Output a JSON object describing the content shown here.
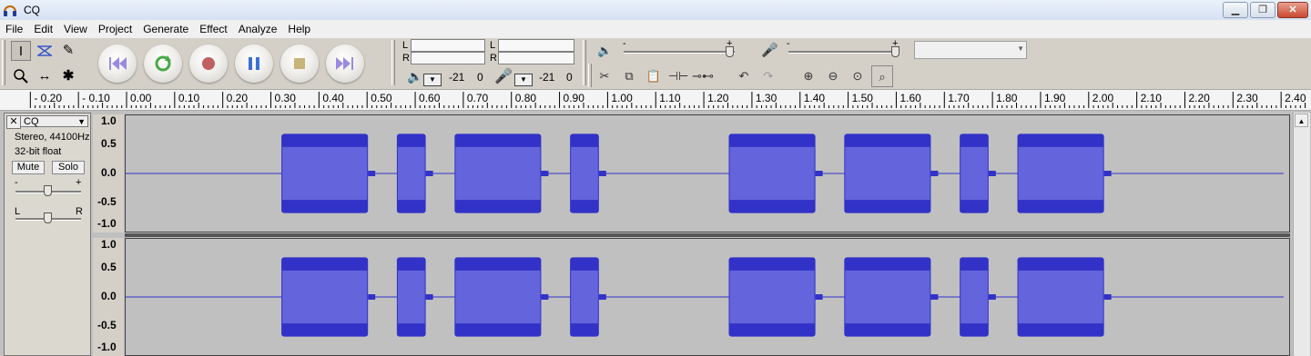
{
  "window": {
    "title": "CQ"
  },
  "menu": [
    "File",
    "Edit",
    "View",
    "Project",
    "Generate",
    "Effect",
    "Analyze",
    "Help"
  ],
  "meters": {
    "play": {
      "left_label": "L",
      "right_label": "R",
      "db_label": "-21",
      "zero_label": "0"
    },
    "record": {
      "left_label": "L",
      "right_label": "R",
      "db_label": "-21",
      "zero_label": "0"
    }
  },
  "mixer": {
    "output_min": "-",
    "output_max": "+",
    "input_min": "-",
    "input_max": "+"
  },
  "ruler": {
    "ticks": [
      "- 0.20",
      "- 0.10",
      "0.00",
      "0.10",
      "0.20",
      "0.30",
      "0.40",
      "0.50",
      "0.60",
      "0.70",
      "0.80",
      "0.90",
      "1.00",
      "1.10",
      "1.20",
      "1.30",
      "1.40",
      "1.50",
      "1.60",
      "1.70",
      "1.80",
      "1.90",
      "2.00",
      "2.10",
      "2.20",
      "2.30",
      "2.40"
    ]
  },
  "track": {
    "name": "CQ",
    "format": "Stereo, 44100Hz",
    "bitdepth": "32-bit float",
    "mute_label": "Mute",
    "solo_label": "Solo",
    "gain_min": "-",
    "gain_max": "+",
    "pan_left": "L",
    "pan_right": "R",
    "scale": [
      "1.0",
      "0.5",
      "0.0",
      "-0.5",
      "-1.0"
    ],
    "bursts": [
      [
        0.32,
        0.5
      ],
      [
        0.56,
        0.62
      ],
      [
        0.68,
        0.86
      ],
      [
        0.92,
        0.98
      ],
      [
        1.25,
        1.43
      ],
      [
        1.49,
        1.67
      ],
      [
        1.73,
        1.79
      ],
      [
        1.85,
        2.03
      ]
    ]
  },
  "colors": {
    "waveform": "#3232c8",
    "waveform_rms": "#6464dc",
    "background": "#d4d0c8"
  }
}
